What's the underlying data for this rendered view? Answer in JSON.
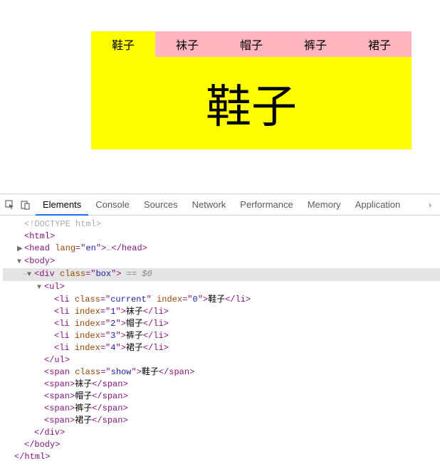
{
  "page": {
    "tabs": [
      "鞋子",
      "袜子",
      "帽子",
      "裤子",
      "裙子"
    ],
    "active_tab_index": 0,
    "panel_text": "鞋子"
  },
  "devtools": {
    "icons": {
      "inspect": "⬚",
      "device": "⧉"
    },
    "tabs": [
      "Elements",
      "Console",
      "Sources",
      "Network",
      "Performance",
      "Memory",
      "Application"
    ],
    "active_tab_index": 0,
    "overflow_glyph": "›",
    "dom_lines": [
      {
        "indent": 0,
        "caret": "none",
        "selected": false,
        "dot": false,
        "segments": [
          {
            "t": "<!DOCTYPE html>",
            "c": "doctype"
          }
        ]
      },
      {
        "indent": 0,
        "caret": "none",
        "selected": false,
        "dot": false,
        "segments": [
          {
            "t": "<",
            "c": "tagc"
          },
          {
            "t": "html",
            "c": "tagc"
          },
          {
            "t": ">",
            "c": "tagc"
          }
        ]
      },
      {
        "indent": 0,
        "caret": "right",
        "selected": false,
        "dot": false,
        "segments": [
          {
            "t": "<",
            "c": "tagc"
          },
          {
            "t": "head",
            "c": "tagc"
          },
          {
            "t": " ",
            "c": "txt"
          },
          {
            "t": "lang",
            "c": "attrn"
          },
          {
            "t": "=\"",
            "c": "tagc"
          },
          {
            "t": "en",
            "c": "attrv"
          },
          {
            "t": "\"",
            "c": "tagc"
          },
          {
            "t": ">",
            "c": "tagc"
          },
          {
            "t": "…",
            "c": "ellipsis"
          },
          {
            "t": "</",
            "c": "tagc"
          },
          {
            "t": "head",
            "c": "tagc"
          },
          {
            "t": ">",
            "c": "tagc"
          }
        ]
      },
      {
        "indent": 0,
        "caret": "down",
        "selected": false,
        "dot": false,
        "segments": [
          {
            "t": "<",
            "c": "tagc"
          },
          {
            "t": "body",
            "c": "tagc"
          },
          {
            "t": ">",
            "c": "tagc"
          }
        ]
      },
      {
        "indent": 1,
        "caret": "down",
        "selected": true,
        "dot": true,
        "segments": [
          {
            "t": "<",
            "c": "tagc"
          },
          {
            "t": "div",
            "c": "tagc"
          },
          {
            "t": " ",
            "c": "txt"
          },
          {
            "t": "class",
            "c": "attrn"
          },
          {
            "t": "=\"",
            "c": "tagc"
          },
          {
            "t": "box",
            "c": "attrv"
          },
          {
            "t": "\"",
            "c": "tagc"
          },
          {
            "t": ">",
            "c": "tagc"
          },
          {
            "t": " == $0",
            "c": "eqsign"
          }
        ]
      },
      {
        "indent": 2,
        "caret": "down",
        "selected": false,
        "dot": false,
        "segments": [
          {
            "t": "<",
            "c": "tagc"
          },
          {
            "t": "ul",
            "c": "tagc"
          },
          {
            "t": ">",
            "c": "tagc"
          }
        ]
      },
      {
        "indent": 3,
        "caret": "none",
        "selected": false,
        "dot": false,
        "segments": [
          {
            "t": "<",
            "c": "tagc"
          },
          {
            "t": "li",
            "c": "tagc"
          },
          {
            "t": " ",
            "c": "txt"
          },
          {
            "t": "class",
            "c": "attrn"
          },
          {
            "t": "=\"",
            "c": "tagc"
          },
          {
            "t": "current",
            "c": "attrv"
          },
          {
            "t": "\"",
            "c": "tagc"
          },
          {
            "t": " ",
            "c": "txt"
          },
          {
            "t": "index",
            "c": "attrn"
          },
          {
            "t": "=\"",
            "c": "tagc"
          },
          {
            "t": "0",
            "c": "attrv"
          },
          {
            "t": "\"",
            "c": "tagc"
          },
          {
            "t": ">",
            "c": "tagc"
          },
          {
            "t": "鞋子",
            "c": "txt"
          },
          {
            "t": "</",
            "c": "tagc"
          },
          {
            "t": "li",
            "c": "tagc"
          },
          {
            "t": ">",
            "c": "tagc"
          }
        ]
      },
      {
        "indent": 3,
        "caret": "none",
        "selected": false,
        "dot": false,
        "segments": [
          {
            "t": "<",
            "c": "tagc"
          },
          {
            "t": "li",
            "c": "tagc"
          },
          {
            "t": " ",
            "c": "txt"
          },
          {
            "t": "index",
            "c": "attrn"
          },
          {
            "t": "=\"",
            "c": "tagc"
          },
          {
            "t": "1",
            "c": "attrv"
          },
          {
            "t": "\"",
            "c": "tagc"
          },
          {
            "t": ">",
            "c": "tagc"
          },
          {
            "t": "袜子",
            "c": "txt"
          },
          {
            "t": "</",
            "c": "tagc"
          },
          {
            "t": "li",
            "c": "tagc"
          },
          {
            "t": ">",
            "c": "tagc"
          }
        ]
      },
      {
        "indent": 3,
        "caret": "none",
        "selected": false,
        "dot": false,
        "segments": [
          {
            "t": "<",
            "c": "tagc"
          },
          {
            "t": "li",
            "c": "tagc"
          },
          {
            "t": " ",
            "c": "txt"
          },
          {
            "t": "index",
            "c": "attrn"
          },
          {
            "t": "=\"",
            "c": "tagc"
          },
          {
            "t": "2",
            "c": "attrv"
          },
          {
            "t": "\"",
            "c": "tagc"
          },
          {
            "t": ">",
            "c": "tagc"
          },
          {
            "t": "帽子",
            "c": "txt"
          },
          {
            "t": "</",
            "c": "tagc"
          },
          {
            "t": "li",
            "c": "tagc"
          },
          {
            "t": ">",
            "c": "tagc"
          }
        ]
      },
      {
        "indent": 3,
        "caret": "none",
        "selected": false,
        "dot": false,
        "segments": [
          {
            "t": "<",
            "c": "tagc"
          },
          {
            "t": "li",
            "c": "tagc"
          },
          {
            "t": " ",
            "c": "txt"
          },
          {
            "t": "index",
            "c": "attrn"
          },
          {
            "t": "=\"",
            "c": "tagc"
          },
          {
            "t": "3",
            "c": "attrv"
          },
          {
            "t": "\"",
            "c": "tagc"
          },
          {
            "t": ">",
            "c": "tagc"
          },
          {
            "t": "裤子",
            "c": "txt"
          },
          {
            "t": "</",
            "c": "tagc"
          },
          {
            "t": "li",
            "c": "tagc"
          },
          {
            "t": ">",
            "c": "tagc"
          }
        ]
      },
      {
        "indent": 3,
        "caret": "none",
        "selected": false,
        "dot": false,
        "segments": [
          {
            "t": "<",
            "c": "tagc"
          },
          {
            "t": "li",
            "c": "tagc"
          },
          {
            "t": " ",
            "c": "txt"
          },
          {
            "t": "index",
            "c": "attrn"
          },
          {
            "t": "=\"",
            "c": "tagc"
          },
          {
            "t": "4",
            "c": "attrv"
          },
          {
            "t": "\"",
            "c": "tagc"
          },
          {
            "t": ">",
            "c": "tagc"
          },
          {
            "t": "裙子",
            "c": "txt"
          },
          {
            "t": "</",
            "c": "tagc"
          },
          {
            "t": "li",
            "c": "tagc"
          },
          {
            "t": ">",
            "c": "tagc"
          }
        ]
      },
      {
        "indent": 2,
        "caret": "none",
        "selected": false,
        "dot": false,
        "segments": [
          {
            "t": "</",
            "c": "tagc"
          },
          {
            "t": "ul",
            "c": "tagc"
          },
          {
            "t": ">",
            "c": "tagc"
          }
        ]
      },
      {
        "indent": 2,
        "caret": "none",
        "selected": false,
        "dot": false,
        "segments": [
          {
            "t": "<",
            "c": "tagc"
          },
          {
            "t": "span",
            "c": "tagc"
          },
          {
            "t": " ",
            "c": "txt"
          },
          {
            "t": "class",
            "c": "attrn"
          },
          {
            "t": "=\"",
            "c": "tagc"
          },
          {
            "t": "show",
            "c": "attrv"
          },
          {
            "t": "\"",
            "c": "tagc"
          },
          {
            "t": ">",
            "c": "tagc"
          },
          {
            "t": "鞋子",
            "c": "txt"
          },
          {
            "t": "</",
            "c": "tagc"
          },
          {
            "t": "span",
            "c": "tagc"
          },
          {
            "t": ">",
            "c": "tagc"
          }
        ]
      },
      {
        "indent": 2,
        "caret": "none",
        "selected": false,
        "dot": false,
        "segments": [
          {
            "t": "<",
            "c": "tagc"
          },
          {
            "t": "span",
            "c": "tagc"
          },
          {
            "t": ">",
            "c": "tagc"
          },
          {
            "t": "袜子",
            "c": "txt"
          },
          {
            "t": "</",
            "c": "tagc"
          },
          {
            "t": "span",
            "c": "tagc"
          },
          {
            "t": ">",
            "c": "tagc"
          }
        ]
      },
      {
        "indent": 2,
        "caret": "none",
        "selected": false,
        "dot": false,
        "segments": [
          {
            "t": "<",
            "c": "tagc"
          },
          {
            "t": "span",
            "c": "tagc"
          },
          {
            "t": ">",
            "c": "tagc"
          },
          {
            "t": "帽子",
            "c": "txt"
          },
          {
            "t": "</",
            "c": "tagc"
          },
          {
            "t": "span",
            "c": "tagc"
          },
          {
            "t": ">",
            "c": "tagc"
          }
        ]
      },
      {
        "indent": 2,
        "caret": "none",
        "selected": false,
        "dot": false,
        "segments": [
          {
            "t": "<",
            "c": "tagc"
          },
          {
            "t": "span",
            "c": "tagc"
          },
          {
            "t": ">",
            "c": "tagc"
          },
          {
            "t": "裤子",
            "c": "txt"
          },
          {
            "t": "</",
            "c": "tagc"
          },
          {
            "t": "span",
            "c": "tagc"
          },
          {
            "t": ">",
            "c": "tagc"
          }
        ]
      },
      {
        "indent": 2,
        "caret": "none",
        "selected": false,
        "dot": false,
        "segments": [
          {
            "t": "<",
            "c": "tagc"
          },
          {
            "t": "span",
            "c": "tagc"
          },
          {
            "t": ">",
            "c": "tagc"
          },
          {
            "t": "裙子",
            "c": "txt"
          },
          {
            "t": "</",
            "c": "tagc"
          },
          {
            "t": "span",
            "c": "tagc"
          },
          {
            "t": ">",
            "c": "tagc"
          }
        ]
      },
      {
        "indent": 1,
        "caret": "none",
        "selected": false,
        "dot": false,
        "segments": [
          {
            "t": "</",
            "c": "tagc"
          },
          {
            "t": "div",
            "c": "tagc"
          },
          {
            "t": ">",
            "c": "tagc"
          }
        ]
      },
      {
        "indent": 0,
        "caret": "none",
        "selected": false,
        "dot": false,
        "segments": [
          {
            "t": "</",
            "c": "tagc"
          },
          {
            "t": "body",
            "c": "tagc"
          },
          {
            "t": ">",
            "c": "tagc"
          }
        ]
      },
      {
        "indent": 0,
        "caret": "none",
        "selected": false,
        "dot": false,
        "close_html": true,
        "segments": [
          {
            "t": "</",
            "c": "tagc"
          },
          {
            "t": "html",
            "c": "tagc"
          },
          {
            "t": ">",
            "c": "tagc"
          }
        ]
      }
    ]
  }
}
